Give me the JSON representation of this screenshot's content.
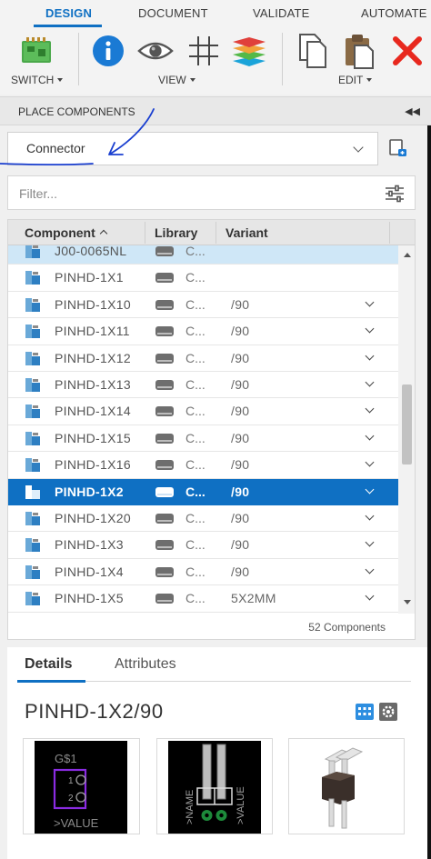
{
  "ribbon": {
    "tabs": [
      "DESIGN",
      "DOCUMENT",
      "VALIDATE",
      "AUTOMATE"
    ],
    "active_tab": "DESIGN",
    "groups": [
      {
        "label": "SWITCH",
        "icons": [
          "board-switch-icon"
        ]
      },
      {
        "label": "VIEW",
        "icons": [
          "info-icon",
          "eye-icon",
          "grid-icon",
          "layers-icon"
        ]
      },
      {
        "label": "EDIT",
        "icons": [
          "copy-icon",
          "paste-icon",
          "delete-icon"
        ]
      }
    ]
  },
  "palette": {
    "title": "PLACE COMPONENTS",
    "collapse_icon": "double-chevron-left-icon"
  },
  "library_select": {
    "value": "Connector",
    "add_icon": "library-add-icon"
  },
  "filter": {
    "placeholder": "Filter...",
    "settings_icon": "sliders-icon"
  },
  "table": {
    "columns": [
      "Component",
      "Library",
      "Variant"
    ],
    "sort_column": "Component",
    "rows": [
      {
        "name": "J00-0065NL",
        "library": "C...",
        "variant": "",
        "has_dropdown": false,
        "state": "highlighted"
      },
      {
        "name": "PINHD-1X1",
        "library": "C...",
        "variant": "",
        "has_dropdown": false,
        "state": "normal"
      },
      {
        "name": "PINHD-1X10",
        "library": "C...",
        "variant": "/90",
        "has_dropdown": true,
        "state": "normal"
      },
      {
        "name": "PINHD-1X11",
        "library": "C...",
        "variant": "/90",
        "has_dropdown": true,
        "state": "normal"
      },
      {
        "name": "PINHD-1X12",
        "library": "C...",
        "variant": "/90",
        "has_dropdown": true,
        "state": "normal"
      },
      {
        "name": "PINHD-1X13",
        "library": "C...",
        "variant": "/90",
        "has_dropdown": true,
        "state": "normal"
      },
      {
        "name": "PINHD-1X14",
        "library": "C...",
        "variant": "/90",
        "has_dropdown": true,
        "state": "normal"
      },
      {
        "name": "PINHD-1X15",
        "library": "C...",
        "variant": "/90",
        "has_dropdown": true,
        "state": "normal"
      },
      {
        "name": "PINHD-1X16",
        "library": "C...",
        "variant": "/90",
        "has_dropdown": true,
        "state": "normal"
      },
      {
        "name": "PINHD-1X2",
        "library": "C...",
        "variant": "/90",
        "has_dropdown": true,
        "state": "selected"
      },
      {
        "name": "PINHD-1X20",
        "library": "C...",
        "variant": "/90",
        "has_dropdown": true,
        "state": "normal"
      },
      {
        "name": "PINHD-1X3",
        "library": "C...",
        "variant": "/90",
        "has_dropdown": true,
        "state": "normal"
      },
      {
        "name": "PINHD-1X4",
        "library": "C...",
        "variant": "/90",
        "has_dropdown": true,
        "state": "normal"
      },
      {
        "name": "PINHD-1X5",
        "library": "C...",
        "variant": "5X2MM",
        "has_dropdown": true,
        "state": "normal"
      }
    ],
    "scroll_position": 0.48,
    "scroll_visible_fraction": 0.24,
    "count_label": "52 Components"
  },
  "details": {
    "tabs": [
      "Details",
      "Attributes"
    ],
    "active_tab": "Details",
    "title": "PINHD-1X2/90",
    "schematic_symbol": {
      "name_label": "G$1",
      "value_label": ">VALUE",
      "pins": [
        "1",
        "2"
      ]
    },
    "footprint": {
      "name_label": ">NAME",
      "value_label": ">VALUE"
    },
    "preview_icons": [
      "pin-header-3d-model"
    ]
  },
  "colors": {
    "accent": "#0f70c3",
    "selected_row": "#0f70c3",
    "highlighted_row": "#cfe7f7",
    "delete_red": "#e8281e",
    "annotation_ink": "#1a3fd0"
  }
}
